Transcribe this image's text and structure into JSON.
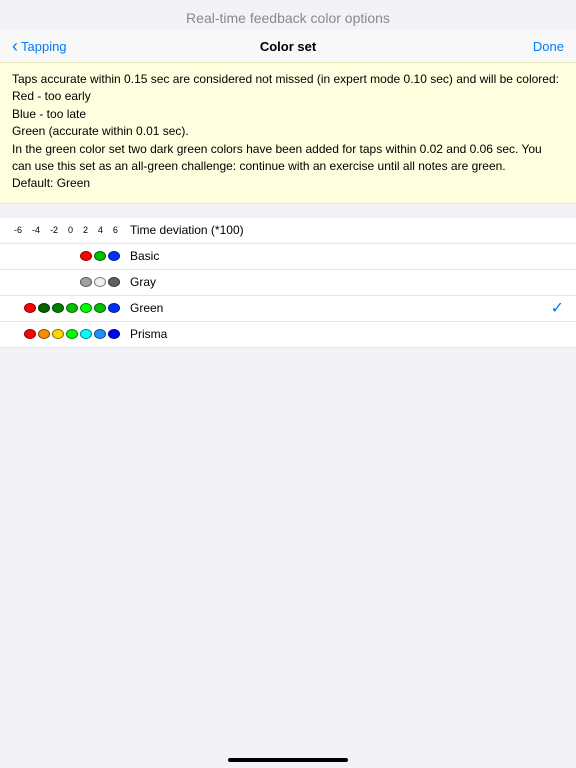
{
  "topTitle": "Real-time feedback color options",
  "nav": {
    "back": "Tapping",
    "title": "Color set",
    "done": "Done"
  },
  "info": {
    "line1": "Taps accurate within 0.15 sec are considered not missed (in expert mode 0.10 sec) and will be colored:",
    "line2": "Red - too early",
    "line3": "Blue - too late",
    "line4": "Green (accurate within 0.01 sec).",
    "line5": "In the green color set two dark green colors have been added for taps within 0.02 and 0.06 sec. You can use this set as an all-green challenge: continue with an exercise until all notes are green.",
    "line6": "Default: Green"
  },
  "header": {
    "ticks": [
      "-6",
      "-4",
      "-2",
      "0",
      "2",
      "4",
      "6"
    ],
    "label": "Time deviation (*100)"
  },
  "rows": [
    {
      "name": "Basic",
      "selected": false,
      "colors": [
        "#ff0000",
        "#00c000",
        "#0030ff"
      ]
    },
    {
      "name": "Gray",
      "selected": false,
      "colors": [
        "#a0a0a0",
        "#f0f0f0",
        "#606060"
      ]
    },
    {
      "name": "Green",
      "selected": true,
      "colors": [
        "#ff0000",
        "#006400",
        "#008000",
        "#00c000",
        "#00ff00",
        "#00c000",
        "#0030ff"
      ]
    },
    {
      "name": "Prisma",
      "selected": false,
      "colors": [
        "#ff0000",
        "#ff8c00",
        "#ffd700",
        "#00ff00",
        "#00ffff",
        "#1e90ff",
        "#0000ff"
      ]
    }
  ]
}
